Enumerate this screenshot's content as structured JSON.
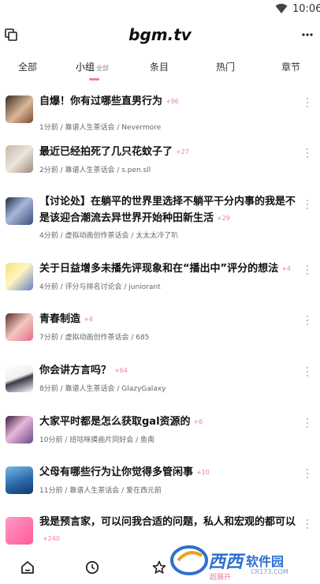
{
  "status_bar": {
    "time": "10:06"
  },
  "app_bar": {
    "title": "bgm.tv"
  },
  "tabs": [
    {
      "label": "全部"
    },
    {
      "label": "小组",
      "sub": "全部"
    },
    {
      "label": "条目"
    },
    {
      "label": "热门"
    },
    {
      "label": "章节"
    }
  ],
  "topics": [
    {
      "title": "自爆！你有过哪些直男行为",
      "count": "+96",
      "meta": "1分前 / 靠谱人生茶话会 / Nevermore"
    },
    {
      "title": "最近已经拍死了几只花蚊子了",
      "count": "+27",
      "meta": "2分前 / 靠谱人生茶话会 / s.pen.sll"
    },
    {
      "title": "【讨论处】在躺平的世界里选择不躺平干分内事的我是不是该迎合潮流去异世界开始种田新生活",
      "count": "+29",
      "meta": "4分前 / 虚拟动画创作茶话会 / 太太太冷了叭"
    },
    {
      "title": "关于日益增多未播先评现象和在“播出中”评分的想法",
      "count": "+4",
      "meta": "4分前 / 评分与排名讨论会 / juniorant"
    },
    {
      "title": "青春制造",
      "count": "+4",
      "meta": "7分前 / 虚拟动画创作茶话会 / 685"
    },
    {
      "title": "你会讲方言吗？",
      "count": "+64",
      "meta": "8分前 / 靠谱人生茶话会 / GlazyGalaxy"
    },
    {
      "title": "大家平时都是怎么获取gal资源的",
      "count": "+6",
      "meta": "10分前 / 班咕咪摸画片同好会 / 鱼南"
    },
    {
      "title": "父母有哪些行为让你觉得多管闲事",
      "count": "+10",
      "meta": "11分前 / 靠谱人生茶话会 / 爱在西元前"
    },
    {
      "title": "我是预言家，可以问我合适的问题，私人和宏观的都可以",
      "count": "+240",
      "meta": ""
    }
  ],
  "bottom_nav": {
    "label": "超展开"
  },
  "watermark": {
    "brand": "西西",
    "brand2": "软件园",
    "url": "CR173.COM"
  },
  "colors": {
    "accent": "#f07ea0",
    "text": "#111111",
    "meta": "#666666"
  }
}
